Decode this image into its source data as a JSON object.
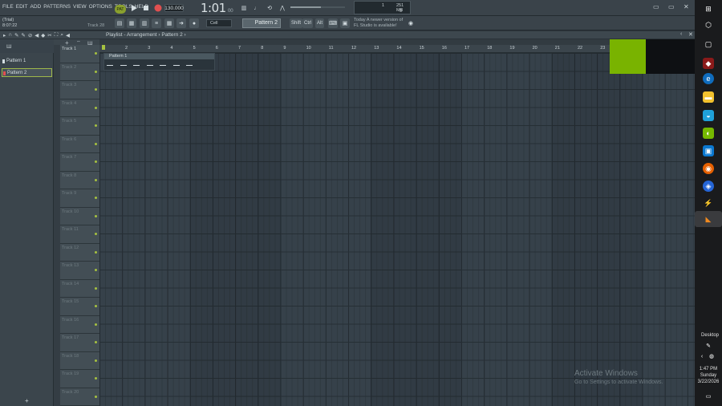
{
  "menu": [
    "FILE",
    "EDIT",
    "ADD",
    "PATTERNS",
    "VIEW",
    "OPTIONS",
    "TOOLS",
    "HELP"
  ],
  "transport": {
    "mode_label": "PAT",
    "tempo": "130.000",
    "time": "1:01",
    "time_sub": "00",
    "cpu_a": "1",
    "cpu_b": "251 MB",
    "cpu_c": "0"
  },
  "status": {
    "trial": "(Trial)",
    "elapsed": "8:07:22",
    "hint": "Track 28"
  },
  "toolbar2": {
    "snap": "Cell",
    "pattern": "Pattern 2",
    "shift": "Shift",
    "ctrl": "Ctrl",
    "alt": "Alt",
    "news_line1": "Today  A newer version of",
    "news_line2": "FL Studio is available!"
  },
  "playlist": {
    "title": "Playlist - Arrangement › Pattern 2 ›",
    "picker": [
      "Pattern 1",
      "Pattern 2"
    ],
    "tracks": [
      "Track 1",
      "Track 2",
      "Track 3",
      "Track 4",
      "Track 5",
      "Track 6",
      "Track 7",
      "Track 8",
      "Track 9",
      "Track 10",
      "Track 11",
      "Track 12",
      "Track 13",
      "Track 14",
      "Track 15",
      "Track 16",
      "Track 17",
      "Track 18",
      "Track 19",
      "Track 20"
    ],
    "ruler": [
      "2",
      "3",
      "4",
      "5",
      "6",
      "7",
      "8",
      "9",
      "10",
      "11",
      "12",
      "13",
      "14",
      "15",
      "16",
      "17",
      "18",
      "19",
      "20",
      "21",
      "22",
      "23"
    ],
    "clip_label": "Pattern 1"
  },
  "watermark": {
    "line1": "Activate Windows",
    "line2": "Go to Settings to activate Windows."
  },
  "taskbar": {
    "desktop": "Desktop",
    "time": "1:47 PM",
    "day": "Sunday",
    "date": "3/22/2026"
  }
}
